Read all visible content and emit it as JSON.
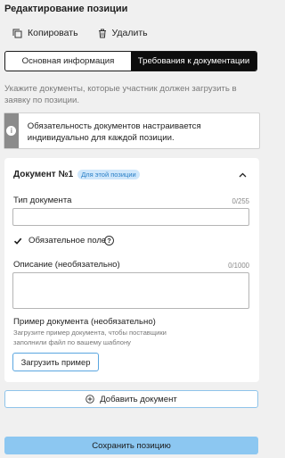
{
  "header": {
    "title": "Редактирование позиции"
  },
  "actions": {
    "copy_label": "Копировать",
    "delete_label": "Удалить"
  },
  "tabs": [
    {
      "label": "Основная информация",
      "active": false
    },
    {
      "label": "Требования к документации",
      "active": true
    }
  ],
  "hint": "Укажите документы, которые участник должен загрузить в заявку по позиции.",
  "notice": {
    "text": "Обязательность документов настраивается индивидуально для каждой позиции."
  },
  "document": {
    "title": "Документ №1",
    "badge": "Для этой позиции",
    "type_label": "Тип документа",
    "type_counter": "0/255",
    "type_value": "",
    "required_label": "Обязательное поле",
    "required_checked": true,
    "description_label": "Описание (необязательно)",
    "description_counter": "0/1000",
    "description_value": "",
    "example_label": "Пример документа (необязательно)",
    "example_hint": "Загрузите пример документа, чтобы поставщики заполнили файл по вашему шаблону",
    "upload_label": "Загрузить пример"
  },
  "add_document_label": "Добавить документ",
  "save_label": "Сохранить позицию",
  "colors": {
    "primary": "#8cc7f1",
    "accent_border": "#5aa6e0",
    "tab_active": "#0d0d0d",
    "notice_bar": "#8b8b8b"
  },
  "icons": {
    "copy": "copy-icon",
    "delete": "trash-icon",
    "info": "info-icon",
    "collapse": "chevron-up-icon",
    "help": "question-icon",
    "add": "plus-circle-icon"
  }
}
